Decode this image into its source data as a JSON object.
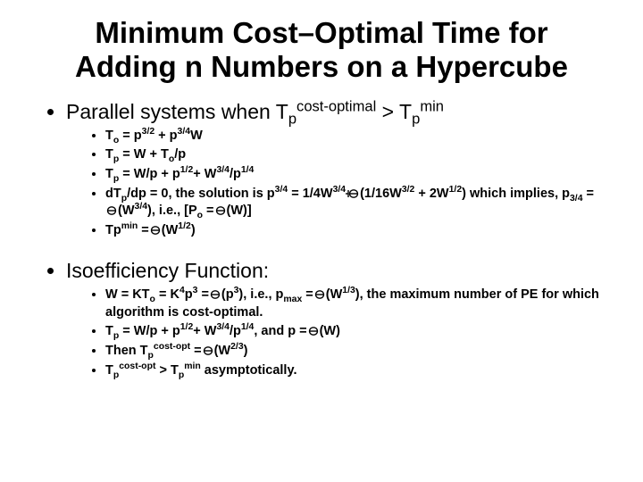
{
  "title_l1": "Minimum Cost–Optimal Time for",
  "title_l2": "Adding n Numbers on a Hypercube",
  "bullet1_a": "Parallel systems when T",
  "bullet1_b": " > T",
  "b1_sub1": "p",
  "b1_sup1": "cost-optimal",
  "b1_sub2": "p",
  "b1_sup2": "min",
  "s1_1a": "T",
  "s1_1b": " = p",
  "s1_1c": " + p",
  "s1_1d": "W",
  "s1_1_sub_o": "o",
  "s1_1_sup32": "3/2",
  "s1_1_sup34": "3/4",
  "s1_2a": "T",
  "s1_2b": " = W + T",
  "s1_2c": "/p",
  "s1_2_sub_p": "p",
  "s1_2_sub_o": "o",
  "s1_3a": "T",
  "s1_3b": " = W/p + p",
  "s1_3c": "+ W",
  "s1_3d": "/p",
  "s1_3_sub_p": "p",
  "s1_3_sup12": "1/2",
  "s1_3_sup34": "3/4",
  "s1_3_sup14": "1/4",
  "s1_4a": "dT",
  "s1_4b": "/dp = 0, the solution is p",
  "s1_4c": " = 1/4W",
  "s1_4d": "(1/16W",
  "s1_4e": " + 2W",
  "s1_4f": ") which implies, p",
  "s1_4g": " =",
  "s1_4h": "(W",
  "s1_4i": "), i.e., [P",
  "s1_4j": " =",
  "s1_4k": "(W)]",
  "s1_4_sub_p": "p",
  "s1_4_sup34": "3/4",
  "s1_4_sup32": "3/2",
  "s1_4_sup12": "1/2",
  "s1_4_sub34": "3/4",
  "s1_4_sub_o": "o",
  "s1_5a": "Tp",
  "s1_5b": " =",
  "s1_5c": "(W",
  "s1_5d": ")",
  "s1_5_sup_min": "min",
  "s1_5_sup12": "1/2",
  "bullet2": "Isoefficiency Function:",
  "s2_1a": "W = KT",
  "s2_1b": " = K",
  "s2_1c": "p",
  "s2_1d": " =",
  "s2_1e": "(p",
  "s2_1f": "), i.e., p",
  "s2_1g": " =",
  "s2_1h": "(W",
  "s2_1i": "), the maximum number of PE for which algorithm is cost-optimal.",
  "s2_1_sub_o": "o",
  "s2_1_sup4": "4",
  "s2_1_sup3": "3",
  "s2_1_sub_max": "max",
  "s2_1_sup13": "1/3",
  "s2_2a": "T",
  "s2_2b": " = W/p + p",
  "s2_2c": "+ W",
  "s2_2d": "/p",
  "s2_2e": ", and p =",
  "s2_2f": "(W)",
  "s2_2_sub_p": "p",
  "s2_2_sup12": "1/2",
  "s2_2_sup34": "3/4",
  "s2_2_sup14": "1/4",
  "s2_3a": "Then T",
  "s2_3b": " =",
  "s2_3c": "(W",
  "s2_3d": ")",
  "s2_3_sub_p": "p",
  "s2_3_sup_co": "cost-opt",
  "s2_3_sup23": "2/3",
  "s2_4a": "T",
  "s2_4b": " > T",
  "s2_4c": " asymptotically.",
  "s2_4_sub_p": "p",
  "s2_4_sup_co": "cost-opt",
  "s2_4_sup_min": "min"
}
